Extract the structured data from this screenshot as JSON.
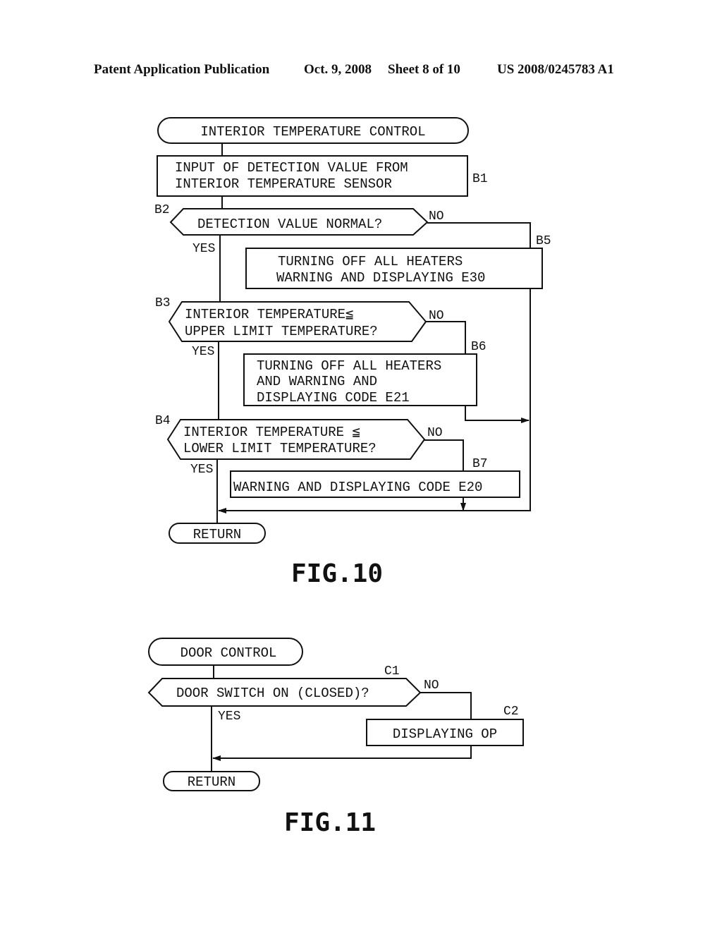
{
  "header": {
    "publication": "Patent Application Publication",
    "date": "Oct. 9, 2008",
    "sheet": "Sheet 8 of 10",
    "number": "US 2008/0245783 A1"
  },
  "fig10": {
    "caption": "FIG.10",
    "start": "INTERIOR TEMPERATURE CONTROL",
    "b1": {
      "id": "B1",
      "lines": [
        "INPUT OF DETECTION VALUE FROM",
        "INTERIOR TEMPERATURE SENSOR"
      ]
    },
    "b2": {
      "id": "B2",
      "lines": [
        "DETECTION VALUE NORMAL?"
      ],
      "yes": "YES",
      "no": "NO"
    },
    "b3": {
      "id": "B3",
      "lines": [
        "INTERIOR TEMPERATURE≦",
        "UPPER LIMIT TEMPERATURE?"
      ],
      "yes": "YES",
      "no": "NO"
    },
    "b4": {
      "id": "B4",
      "lines": [
        "INTERIOR TEMPERATURE ≦",
        "LOWER LIMIT TEMPERATURE?"
      ],
      "yes": "YES",
      "no": "NO"
    },
    "b5": {
      "id": "B5",
      "lines": [
        "TURNING OFF ALL HEATERS",
        "WARNING AND DISPLAYING E30"
      ]
    },
    "b6": {
      "id": "B6",
      "lines": [
        "TURNING OFF ALL HEATERS",
        "AND WARNING AND",
        "DISPLAYING CODE E21"
      ]
    },
    "b7": {
      "id": "B7",
      "lines": [
        "WARNING AND DISPLAYING CODE E20"
      ]
    },
    "end": "RETURN"
  },
  "fig11": {
    "caption": "FIG.11",
    "start": "DOOR CONTROL",
    "c1": {
      "id": "C1",
      "lines": [
        "DOOR SWITCH ON (CLOSED)?"
      ],
      "yes": "YES",
      "no": "NO"
    },
    "c2": {
      "id": "C2",
      "lines": [
        "DISPLAYING OP"
      ]
    },
    "end": "RETURN"
  }
}
